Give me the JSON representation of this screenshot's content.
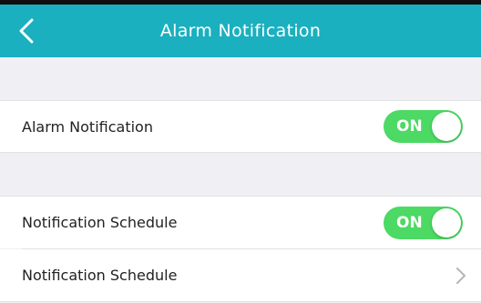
{
  "header": {
    "title": "Alarm Notification",
    "back_icon": "chevron-left-icon",
    "background_color": "#1ab0bf"
  },
  "rows": [
    {
      "label": "Alarm Notification",
      "toggle": {
        "state": "ON",
        "on": true
      }
    },
    {
      "label": "Notification Schedule",
      "toggle": {
        "state": "ON",
        "on": true
      }
    },
    {
      "label": "Notification Schedule",
      "accessory_icon": "chevron-right-icon"
    }
  ],
  "colors": {
    "toggle_on": "#4cd964",
    "page_background": "#efeff4"
  }
}
